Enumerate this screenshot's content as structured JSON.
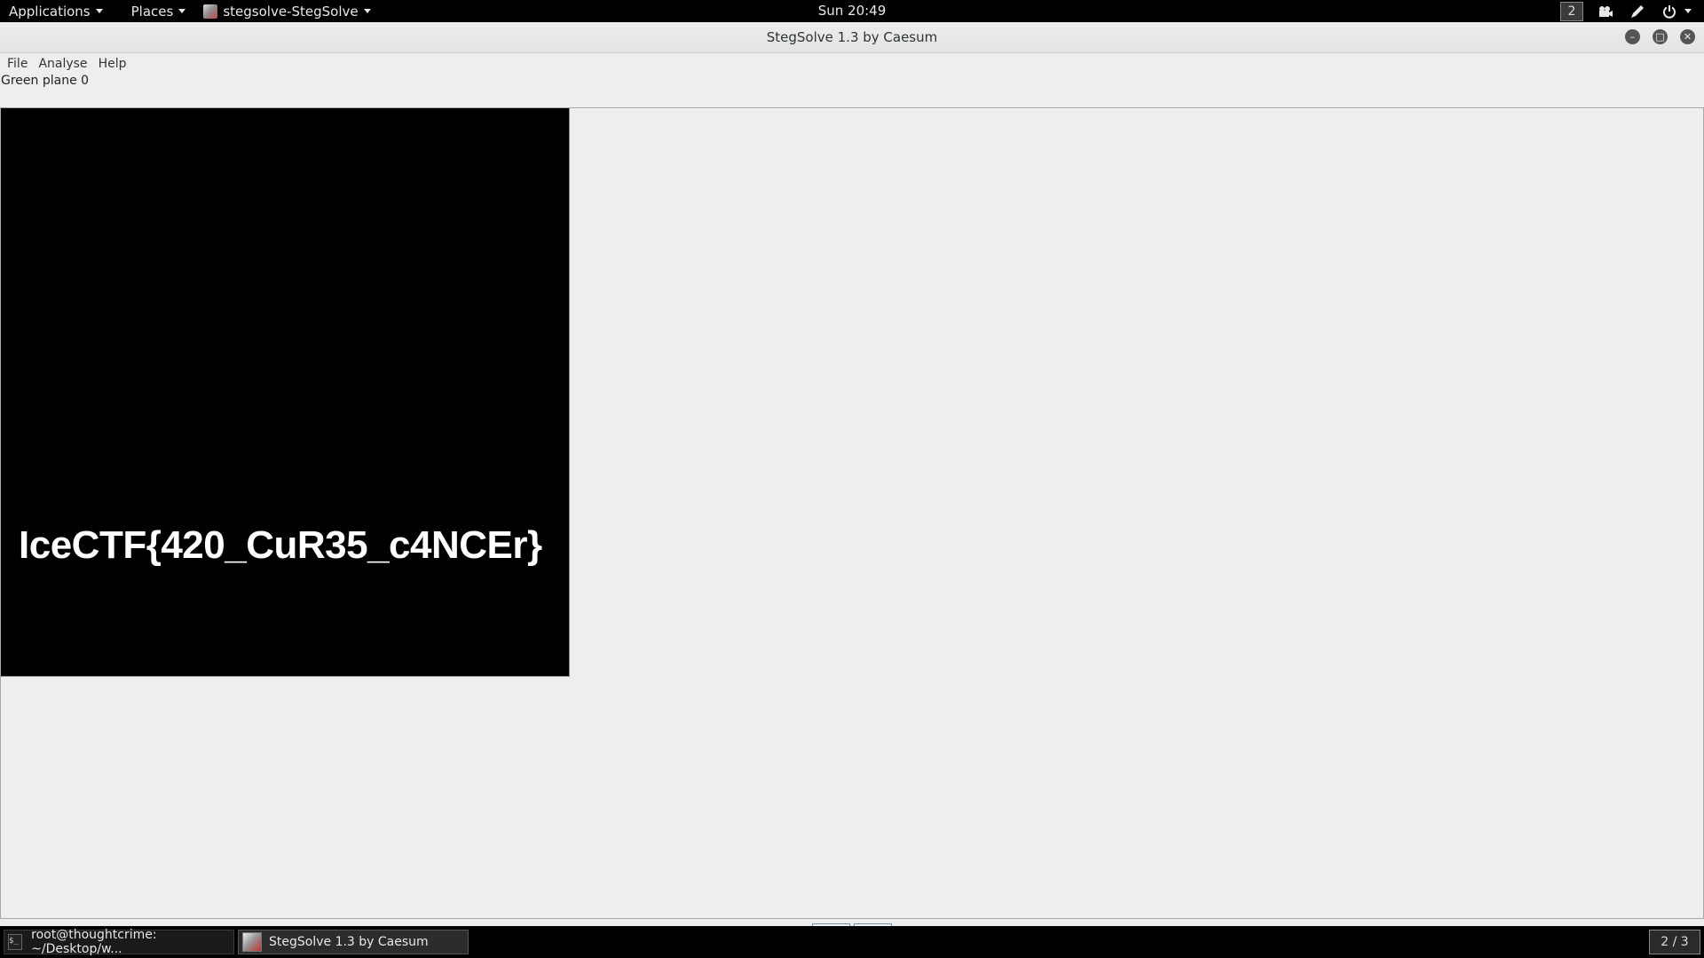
{
  "topbar": {
    "applications_label": "Applications",
    "places_label": "Places",
    "active_app_label": "stegsolve-StegSolve",
    "clock": "Sun 20:49",
    "workspace_badge": "2"
  },
  "window": {
    "title": "StegSolve 1.3 by Caesum",
    "menu": {
      "file": "File",
      "analyse": "Analyse",
      "help": "Help"
    },
    "plane_label": "Green plane 0",
    "image_text": "IceCTF{420_CuR35_c4NCEr}",
    "nav": {
      "prev": "<",
      "next": ">"
    }
  },
  "taskbar": {
    "terminal_task": "root@thoughtcrime: ~/Desktop/w...",
    "stegsolve_task": "StegSolve 1.3 by Caesum",
    "workspace_indicator": "2 / 3"
  },
  "colors": {
    "panel_bg": "#000000",
    "window_bg": "#eeeeee",
    "image_bg": "#000000",
    "image_text": "#ffffff"
  }
}
